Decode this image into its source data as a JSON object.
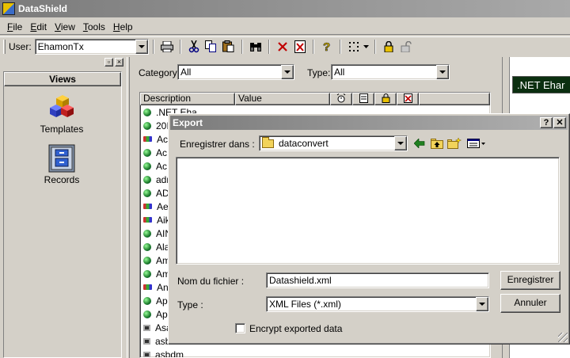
{
  "app": {
    "title": "DataShield"
  },
  "menu": [
    {
      "label": "File",
      "ul": "F",
      "rest": "ile"
    },
    {
      "label": "Edit",
      "ul": "E",
      "rest": "dit"
    },
    {
      "label": "View",
      "ul": "V",
      "rest": "iew"
    },
    {
      "label": "Tools",
      "ul": "T",
      "rest": "ools"
    },
    {
      "label": "Help",
      "ul": "H",
      "rest": "elp"
    }
  ],
  "toolbar": {
    "user_label": "User:",
    "user_value": "EhamonTx",
    "buttons": [
      "printer-icon",
      "scissors-icon",
      "copy-icon",
      "paste-icon",
      "binoculars-icon",
      "delete-icon",
      "delete-record-icon",
      "help-icon",
      "view-grid-icon",
      "lock-icon",
      "unlock-icon"
    ]
  },
  "views": {
    "title": "Views",
    "items": [
      {
        "label": "Templates",
        "icon": "templates-icon"
      },
      {
        "label": "Records",
        "icon": "records-icon"
      }
    ]
  },
  "filters": {
    "category_label": "Category:",
    "category_value": "All",
    "type_label": "Type:",
    "type_value": "All"
  },
  "list": {
    "columns": [
      "Description",
      "Value"
    ],
    "column_icons": [
      "alarm-icon",
      "note-icon",
      "lock-icon",
      "delete-icon"
    ],
    "rows": [
      {
        "text": ".NET Eha",
        "icon": "globe"
      },
      {
        "text": "20I",
        "icon": "globe"
      },
      {
        "text": "Ac",
        "icon": "id"
      },
      {
        "text": "Ac",
        "icon": "globe"
      },
      {
        "text": "Ac",
        "icon": "globe"
      },
      {
        "text": "adr",
        "icon": "globe"
      },
      {
        "text": "AD",
        "icon": "globe"
      },
      {
        "text": "Ae",
        "icon": "id"
      },
      {
        "text": "Aik",
        "icon": "id"
      },
      {
        "text": "AIN",
        "icon": "globe"
      },
      {
        "text": "Ala",
        "icon": "globe"
      },
      {
        "text": "Am",
        "icon": "globe"
      },
      {
        "text": "Am",
        "icon": "globe"
      },
      {
        "text": "An",
        "icon": "id"
      },
      {
        "text": "Ap",
        "icon": "globe"
      },
      {
        "text": "Ap",
        "icon": "globe"
      },
      {
        "text": "Asa",
        "icon": "pc"
      },
      {
        "text": "asb",
        "icon": "pc"
      },
      {
        "text": "asbdm",
        "icon": "pc"
      }
    ]
  },
  "right_pane": {
    "banner": ".NET Ehar"
  },
  "dialog": {
    "title": "Export",
    "help_btn": "?",
    "close_btn": "✕",
    "save_in_label": "Enregistrer dans :",
    "save_in_value": "dataconvert",
    "filename_label": "Nom du fichier :",
    "filename_value": "Datashield.xml",
    "type_label": "Type :",
    "type_value": "XML Files (*.xml)",
    "save_btn": "Enregistrer",
    "cancel_btn": "Annuler",
    "encrypt_label": "Encrypt exported data",
    "encrypt_checked": false
  }
}
